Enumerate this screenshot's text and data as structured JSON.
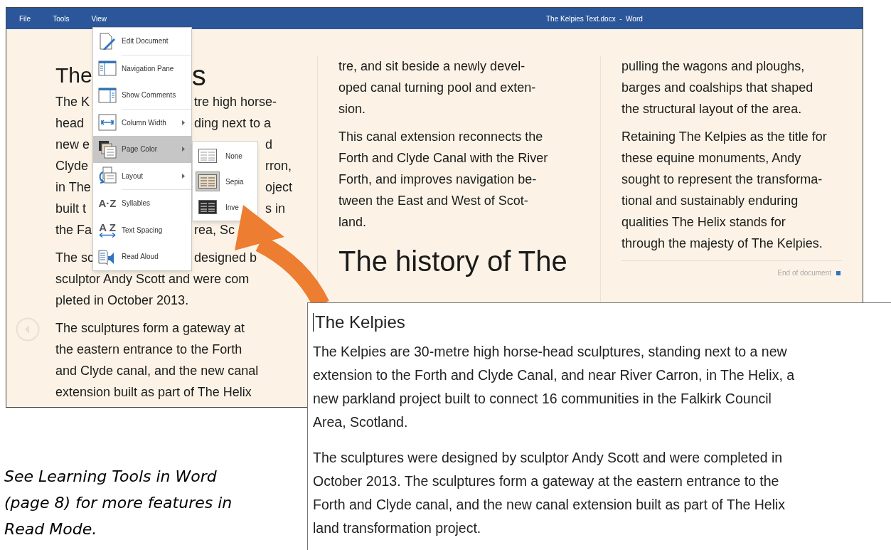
{
  "window": {
    "menu": [
      {
        "label": "File"
      },
      {
        "label": "Tools"
      },
      {
        "label": "View"
      }
    ],
    "title": "The Kelpies Text.docx  -  Word"
  },
  "columns": [
    {
      "blocks": [
        {
          "kind": "heading",
          "left": "The",
          "right": "s"
        },
        {
          "kind": "paragraph",
          "lines": [
            {
              "left": "The K",
              "right": "tre high horse-"
            },
            {
              "left": "head",
              "right": "ding next to a"
            },
            {
              "left": "new e",
              "right": "d"
            },
            {
              "left": "Clyde",
              "right": "rron,"
            },
            {
              "left": "in The",
              "right": "oject"
            },
            {
              "left": "built t",
              "right": "s in"
            },
            {
              "left": "the Fa",
              "right": "rea, Sc"
            }
          ]
        },
        {
          "kind": "paragraph",
          "lines": [
            {
              "left": "The sc",
              "right": "designed b"
            },
            {
              "text": "sculptor Andy Scott and were com"
            },
            {
              "text": "pleted in October 2013."
            }
          ]
        },
        {
          "kind": "paragraph",
          "lines": [
            {
              "text": "The sculptures form a gateway at"
            },
            {
              "text": "the eastern entrance to the Forth"
            },
            {
              "text": "and Clyde canal, and the new canal"
            },
            {
              "text": "extension built as part of The Helix"
            }
          ]
        }
      ]
    },
    {
      "blocks": [
        {
          "kind": "paragraph",
          "lines": [
            {
              "text": "tre, and sit beside a newly devel-"
            },
            {
              "text": "oped canal turning pool and exten-"
            },
            {
              "text": "sion."
            }
          ]
        },
        {
          "kind": "paragraph",
          "lines": [
            {
              "text": "This canal extension reconnects the"
            },
            {
              "text": "Forth and Clyde Canal with the River"
            },
            {
              "text": "Forth, and improves navigation be-"
            },
            {
              "text": "tween the East and West of Scot-"
            },
            {
              "text": "land."
            }
          ]
        },
        {
          "kind": "heading",
          "text": "The history of The"
        }
      ]
    },
    {
      "blocks": [
        {
          "kind": "paragraph",
          "lines": [
            {
              "text": "pulling the wagons and ploughs,"
            },
            {
              "text": "barges and coalships that shaped"
            },
            {
              "text": "the structural layout of the area."
            }
          ]
        },
        {
          "kind": "paragraph",
          "lines": [
            {
              "text": "Retaining The Kelpies as the title for"
            },
            {
              "text": "these equine monuments, Andy"
            },
            {
              "text": "sought to represent the transforma-"
            },
            {
              "text": "tional and sustainably enduring"
            },
            {
              "text": "qualities The Helix stands for"
            },
            {
              "text": "through the majesty of The Kelpies."
            }
          ]
        },
        {
          "kind": "end",
          "text": "End of document"
        }
      ]
    }
  ],
  "view_menu": {
    "groups": [
      {
        "items": [
          {
            "label": "Edit Document",
            "submenu": false,
            "highlighted": false
          }
        ]
      },
      {
        "items": [
          {
            "label": "Navigation Pane",
            "submenu": false,
            "highlighted": false
          },
          {
            "label": "Show Comments",
            "submenu": false,
            "highlighted": false
          }
        ]
      },
      {
        "items": [
          {
            "label": "Column Width",
            "submenu": true,
            "highlighted": false
          },
          {
            "label": "Page Color",
            "submenu": true,
            "highlighted": true
          },
          {
            "label": "Layout",
            "submenu": true,
            "highlighted": false
          }
        ]
      },
      {
        "items": [
          {
            "label": "Syllables",
            "glyph": "A·Z",
            "submenu": false,
            "highlighted": false
          },
          {
            "label": "Text Spacing",
            "glyph": "A Z",
            "submenu": false,
            "highlighted": false
          },
          {
            "label": "Read Aloud",
            "submenu": false,
            "highlighted": false
          }
        ]
      }
    ]
  },
  "page_color_menu": {
    "items": [
      {
        "label": "None",
        "selected": false
      },
      {
        "label": "Sepia",
        "selected": true
      },
      {
        "label": "Inve",
        "selected": false
      }
    ]
  },
  "inset": {
    "heading": "The Kelpies",
    "paragraphs": [
      {
        "lines": [
          "The Kelpies are 30-metre high horse-head sculptures, standing next to a new",
          "extension to the Forth and Clyde Canal, and near River Carron, in The Helix, a",
          "new parkland project built to connect 16 communities in the Falkirk Council",
          "Area, Scotland."
        ]
      },
      {
        "lines": [
          "The sculptures were designed by sculptor Andy Scott and were completed in",
          "October 2013. The sculptures form a gateway at the eastern entrance to the",
          "Forth and Clyde canal, and the new canal extension built as part of The Helix",
          "land transformation project."
        ]
      }
    ]
  },
  "caption": {
    "lines": [
      "See Learning Tools in Word",
      "(page 8) for more features in",
      "Read Mode."
    ]
  }
}
